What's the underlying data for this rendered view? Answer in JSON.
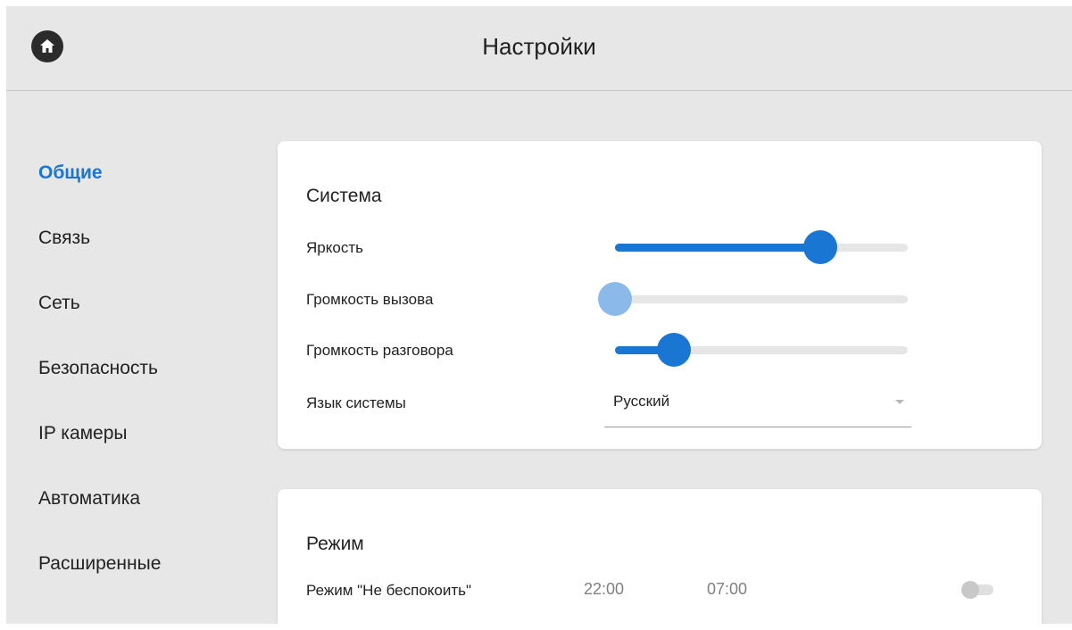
{
  "header": {
    "title": "Настройки",
    "home_icon": "home-icon"
  },
  "sidebar": {
    "items": [
      {
        "label": "Общие",
        "active": true
      },
      {
        "label": "Связь",
        "active": false
      },
      {
        "label": "Сеть",
        "active": false
      },
      {
        "label": "Безопасность",
        "active": false
      },
      {
        "label": "IP камеры",
        "active": false
      },
      {
        "label": "Автоматика",
        "active": false
      },
      {
        "label": "Расширенные",
        "active": false
      }
    ]
  },
  "system": {
    "title": "Система",
    "brightness": {
      "label": "Яркость",
      "value_percent": 70
    },
    "call_volume": {
      "label": "Громкость вызова",
      "value_percent": 0
    },
    "talk_volume": {
      "label": "Громкость разговора",
      "value_percent": 20
    },
    "language": {
      "label": "Язык системы",
      "value": "Русский"
    }
  },
  "mode": {
    "title": "Режим",
    "do_not_disturb": {
      "label": "Режим \"Не беспокоить\"",
      "start": "22:00",
      "end": "07:00",
      "enabled": false
    }
  },
  "colors": {
    "accent": "#1976d2",
    "accent_disabled": "#8ab9ea",
    "background": "#e7e7e7",
    "card": "#ffffff"
  }
}
